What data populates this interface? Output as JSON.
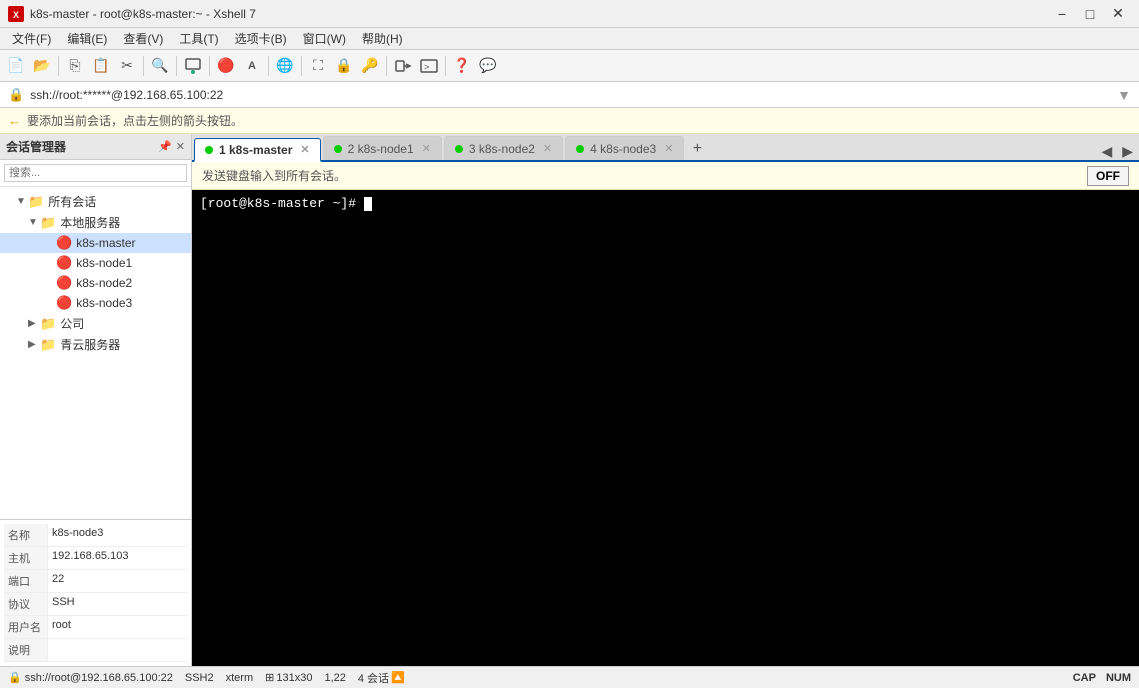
{
  "titlebar": {
    "icon": "X",
    "title": "k8s-master - root@k8s-master:~ - Xshell 7",
    "min": "−",
    "max": "□",
    "close": "✕"
  },
  "menubar": {
    "items": [
      "文件(F)",
      "编辑(E)",
      "查看(V)",
      "工具(T)",
      "选项卡(B)",
      "窗口(W)",
      "帮助(H)"
    ]
  },
  "addressbar": {
    "text": "ssh://root:******@192.168.65.100:22"
  },
  "infobar": {
    "text": "要添加当前会话，点击左侧的箭头按钮。",
    "btn": "OFF"
  },
  "sidebar": {
    "title": "会话管理器",
    "tree": [
      {
        "level": 1,
        "type": "group-expand",
        "label": "所有会话",
        "expanded": true
      },
      {
        "level": 2,
        "type": "group-expand",
        "label": "本地服务器",
        "expanded": true
      },
      {
        "level": 3,
        "type": "server-red",
        "label": "k8s-master"
      },
      {
        "level": 3,
        "type": "server-red",
        "label": "k8s-node1"
      },
      {
        "level": 3,
        "type": "server-red",
        "label": "k8s-node2"
      },
      {
        "level": 3,
        "type": "server-red",
        "label": "k8s-node3"
      },
      {
        "level": 2,
        "type": "group-collapsed",
        "label": "公司"
      },
      {
        "level": 2,
        "type": "group-collapsed",
        "label": "青云服务器"
      }
    ],
    "info": {
      "rows": [
        {
          "label": "名称",
          "value": "k8s-node3"
        },
        {
          "label": "主机",
          "value": "192.168.65.103"
        },
        {
          "label": "端口",
          "value": "22"
        },
        {
          "label": "协议",
          "value": "SSH"
        },
        {
          "label": "用户名",
          "value": "root"
        },
        {
          "label": "说明",
          "value": ""
        }
      ]
    }
  },
  "tabs": [
    {
      "id": 1,
      "label": "1 k8s-master",
      "active": true,
      "dot": "green"
    },
    {
      "id": 2,
      "label": "2 k8s-node1",
      "active": false,
      "dot": "green"
    },
    {
      "id": 3,
      "label": "3 k8s-node2",
      "active": false,
      "dot": "green"
    },
    {
      "id": 4,
      "label": "4 k8s-node3",
      "active": false,
      "dot": "green"
    }
  ],
  "broadcast": {
    "text": "发送键盘输入到所有会话。",
    "toggle": "OFF"
  },
  "terminal": {
    "prompt": "[root@k8s-master ~]# "
  },
  "statusbar": {
    "ssh_text": "ssh://root@192.168.65.100:22",
    "protocol": "SSH2",
    "encoding": "xterm",
    "terminal_size": "131x30",
    "position": "1,22",
    "sessions": "4 会话",
    "cap": "CAP",
    "num": "NUM"
  }
}
